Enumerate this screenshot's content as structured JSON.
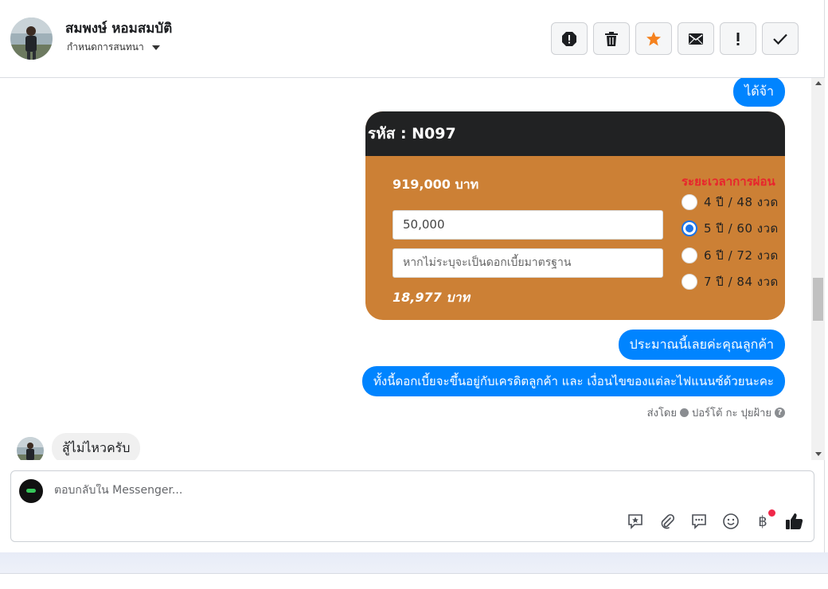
{
  "header": {
    "contact_name": "สมพงษ์ หอมสมบัติ",
    "conversation_settings": "กำหนดการสนทนา"
  },
  "toolbar": {
    "buttons": [
      "alert-icon",
      "trash-icon",
      "star-icon",
      "envelope-icon",
      "exclamation-icon",
      "check-icon"
    ],
    "colors": {
      "star": "#f5821f",
      "button_bg": "#f5f6f7"
    }
  },
  "messages": {
    "reply_ok": "ได้จ้า",
    "estimate": "ประมาณนี้เลยค่ะคุณลูกค้า",
    "credit_note": "ทั้งนี้ดอกเบี้ยจะขึ้นอยู่กับเครดิตลูกค้า และ เงื่อนไขของแต่ละไฟแนนซ์ด้วยนะคะ",
    "sent_by": "ส่งโดย",
    "sender": "ปอร์โต้ กะ ปุยฝ้าย",
    "customer_reply": "สู้ไม่ไหวครับ"
  },
  "loan_card": {
    "code": "รหัส : N097",
    "price": "919,000 บาท",
    "down_payment": "50,000",
    "interest_placeholder": "หากไม่ระบุจะเป็นดอกเบี้ยมาตรฐาน",
    "monthly": "18,977 บาท",
    "term_title": "ระยะเวลาการผ่อน",
    "terms": [
      "4 ปี / 48 งวด",
      "5 ปี / 60 งวด",
      "6 ปี / 72 งวด",
      "7 ปี / 84 งวด"
    ],
    "selected_term": "5 ปี / 60 งวด",
    "colors": {
      "card": "#cc8035",
      "header": "#212223",
      "term_title": "#e8242d",
      "bubble": "#0084ff"
    }
  },
  "composer": {
    "placeholder": "ตอบกลับใน Messenger...",
    "icons": [
      "saved-reply-icon",
      "attachment-icon",
      "quick-reply-icon",
      "emoji-icon",
      "baht-icon",
      "like-icon"
    ]
  }
}
